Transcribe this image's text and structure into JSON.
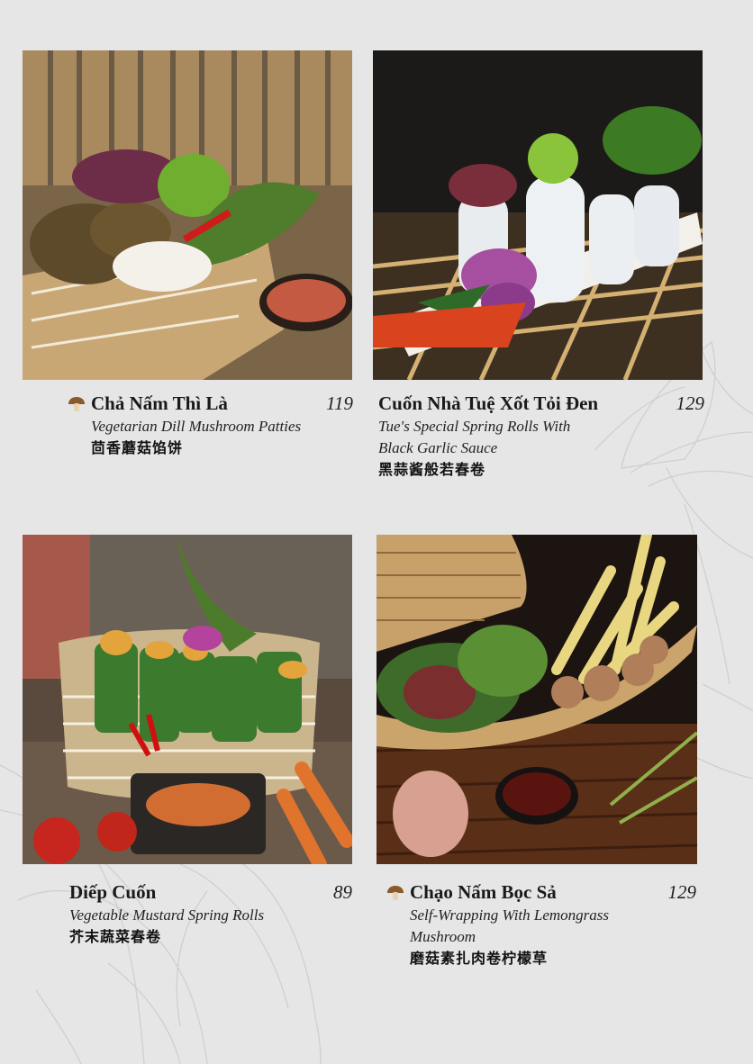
{
  "items": [
    {
      "name": "Chả Nấm Thì Là",
      "price": "119",
      "english": "Vegetarian Dill Mushroom Patties",
      "chinese": "茴香蘑菇馅饼",
      "icon": "mushroom-icon"
    },
    {
      "name": "Cuốn Nhà Tuệ Xốt Tỏi Đen",
      "price": "129",
      "english_line1": "Tue's Special Spring Rolls With",
      "english_line2": "Black Garlic Sauce",
      "chinese": "黑蒜酱般若春卷"
    },
    {
      "name": "Diếp Cuốn",
      "price": "89",
      "english": "Vegetable Mustard Spring Rolls",
      "chinese": "芥末蔬菜春卷"
    },
    {
      "name": "Chạo Nấm Bọc Sả",
      "price": "129",
      "english_line1": "Self-Wrapping With Lemongrass",
      "english_line2": "Mushroom",
      "chinese": "磨菇素扎肉卷柠檬草",
      "icon": "mushroom-icon"
    }
  ],
  "colors": {
    "background": "#e6e6e6",
    "text": "#1a1a1a",
    "mushroom_icon": "#8a5a2c"
  }
}
